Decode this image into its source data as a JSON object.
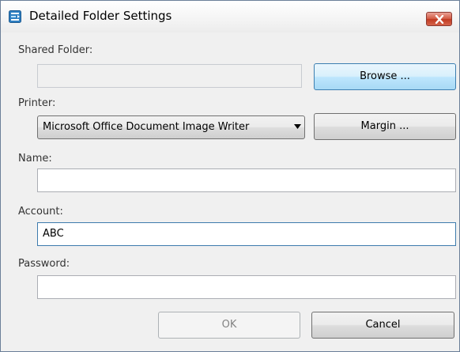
{
  "window": {
    "title": "Detailed Folder Settings",
    "icon": "folder-settings-icon",
    "close_icon": "close-icon"
  },
  "shared_folder": {
    "label": "Shared Folder:",
    "value": "",
    "enabled": false,
    "browse_label": "Browse ..."
  },
  "printer": {
    "label": "Printer:",
    "selected": "Microsoft Office Document Image Writer",
    "dropdown_icon": "chevron-down-icon",
    "margin_label": "Margin ..."
  },
  "name": {
    "label": "Name:",
    "value": ""
  },
  "account": {
    "label": "Account:",
    "value": "ABC"
  },
  "password": {
    "label": "Password:",
    "value": ""
  },
  "buttons": {
    "ok_label": "OK",
    "ok_enabled": false,
    "cancel_label": "Cancel"
  },
  "colors": {
    "dialog_background": "#f0f0f0",
    "close_button": "#c13a22",
    "focus_border": "#3d7bad",
    "hover_button": "#bee6fd"
  }
}
